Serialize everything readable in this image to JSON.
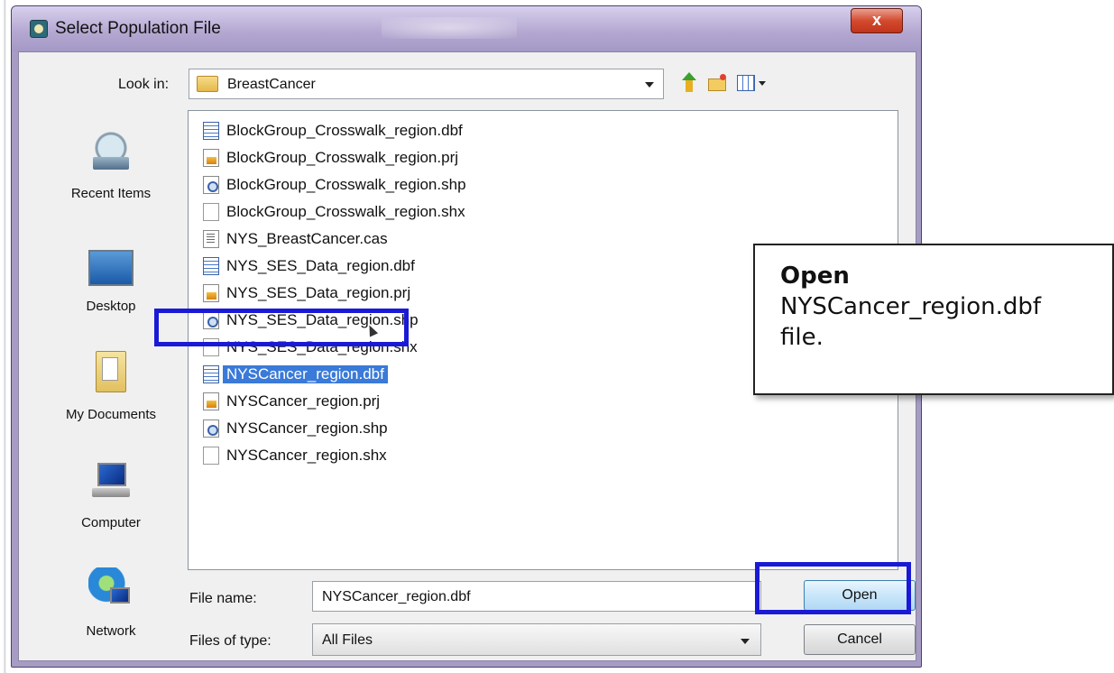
{
  "dialog": {
    "title": "Select Population File",
    "close_label": "x"
  },
  "toolbar": {
    "look_in_label": "Look in:",
    "look_in_value": "BreastCancer",
    "icons": [
      "up-folder-icon",
      "new-folder-icon",
      "view-menu-icon"
    ]
  },
  "places": [
    {
      "label": "Recent Items",
      "icon": "recent-items-icon"
    },
    {
      "label": "Desktop",
      "icon": "desktop-icon"
    },
    {
      "label": "My Documents",
      "icon": "my-documents-icon"
    },
    {
      "label": "Computer",
      "icon": "computer-icon"
    },
    {
      "label": "Network",
      "icon": "network-icon"
    }
  ],
  "files": [
    {
      "name": "BlockGroup_Crosswalk_region.dbf",
      "type": "dbf"
    },
    {
      "name": "BlockGroup_Crosswalk_region.prj",
      "type": "prj"
    },
    {
      "name": "BlockGroup_Crosswalk_region.shp",
      "type": "shp"
    },
    {
      "name": "BlockGroup_Crosswalk_region.shx",
      "type": "shx"
    },
    {
      "name": "NYS_BreastCancer.cas",
      "type": "cas"
    },
    {
      "name": "NYS_SES_Data_region.dbf",
      "type": "dbf"
    },
    {
      "name": "NYS_SES_Data_region.prj",
      "type": "prj"
    },
    {
      "name": "NYS_SES_Data_region.shp",
      "type": "shp"
    },
    {
      "name": "NYS_SES_Data_region.shx",
      "type": "shx"
    },
    {
      "name": "NYSCancer_region.dbf",
      "type": "dbf",
      "selected": true
    },
    {
      "name": "NYSCancer_region.prj",
      "type": "prj"
    },
    {
      "name": "NYSCancer_region.shp",
      "type": "shp"
    },
    {
      "name": "NYSCancer_region.shx",
      "type": "shx"
    }
  ],
  "file_name": {
    "label": "File name:",
    "value": "NYSCancer_region.dbf"
  },
  "file_type": {
    "label": "Files of type:",
    "value": "All Files"
  },
  "buttons": {
    "open": "Open",
    "cancel": "Cancel"
  },
  "callout": {
    "bold": "Open",
    "line1": "NYSCancer_region.dbf",
    "line2": "file."
  },
  "colors": {
    "highlight_box": "#1a1ad6",
    "selection": "#3a7ad8",
    "titlebar": "#b5a9d2"
  }
}
